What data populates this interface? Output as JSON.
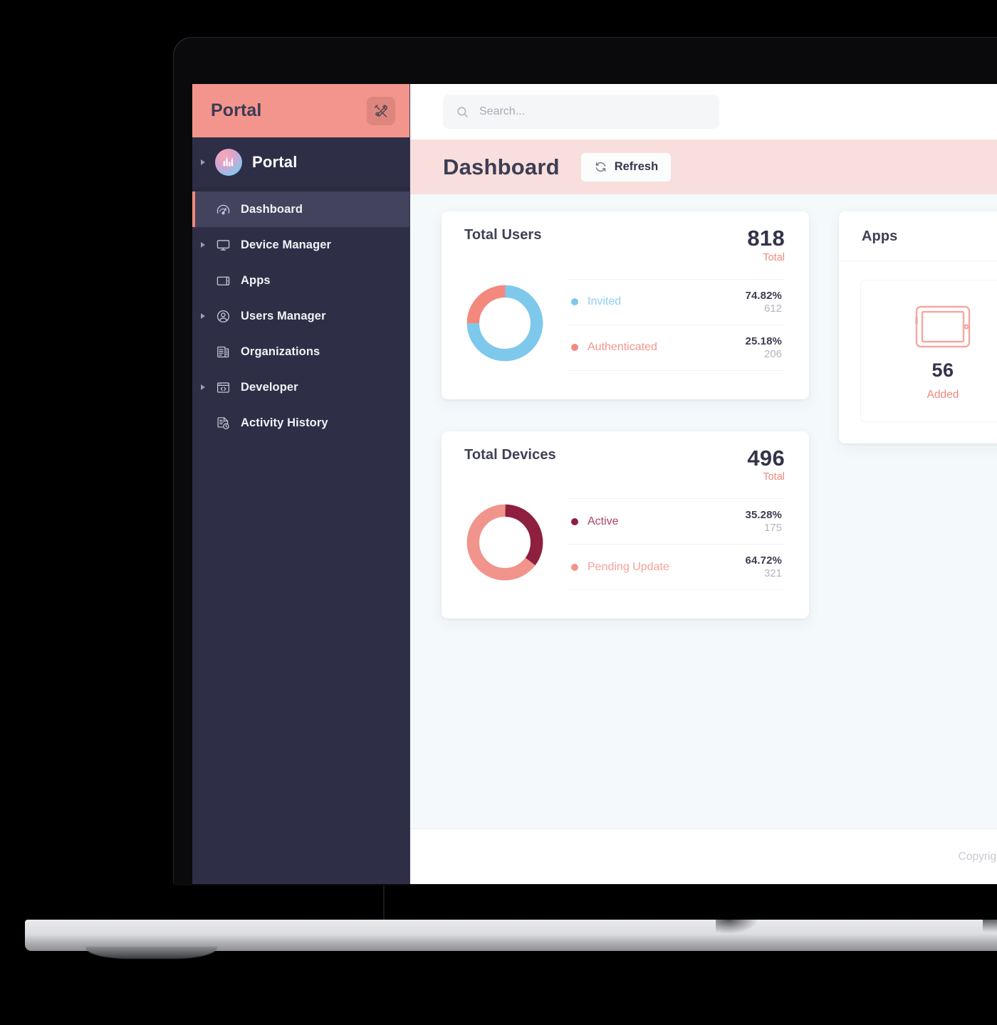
{
  "sidebar": {
    "brand_title": "Portal",
    "tools_icon": "tools-icon",
    "org": {
      "name": "Portal",
      "logo_icon": "portal-logo-icon"
    },
    "items": [
      {
        "label": "Dashboard",
        "icon": "gauge-icon",
        "expandable": false,
        "active": true
      },
      {
        "label": "Device Manager",
        "icon": "monitor-icon",
        "expandable": true,
        "active": false
      },
      {
        "label": "Apps",
        "icon": "tablet-icon",
        "expandable": false,
        "active": false
      },
      {
        "label": "Users Manager",
        "icon": "user-circle-icon",
        "expandable": true,
        "active": false
      },
      {
        "label": "Organizations",
        "icon": "building-icon",
        "expandable": false,
        "active": false
      },
      {
        "label": "Developer",
        "icon": "code-window-icon",
        "expandable": true,
        "active": false
      },
      {
        "label": "Activity History",
        "icon": "document-clock-icon",
        "expandable": false,
        "active": false
      }
    ]
  },
  "topbar": {
    "search_placeholder": "Search...",
    "search_value": "",
    "search_icon": "search-icon"
  },
  "pagebar": {
    "title": "Dashboard",
    "refresh_label": "Refresh",
    "refresh_icon": "refresh-icon"
  },
  "cards": {
    "total_users": {
      "title": "Total Users",
      "total_value": "818",
      "total_label": "Total",
      "rows": [
        {
          "name": "Invited",
          "percent": "74.82%",
          "count": "612",
          "color": "#7ec8ec"
        },
        {
          "name": "Authenticated",
          "percent": "25.18%",
          "count": "206",
          "color": "#f3887d"
        }
      ]
    },
    "total_devices": {
      "title": "Total Devices",
      "total_value": "496",
      "total_label": "Total",
      "rows": [
        {
          "name": "Active",
          "percent": "35.28%",
          "count": "175",
          "color": "#8e1f3f"
        },
        {
          "name": "Pending Update",
          "percent": "64.72%",
          "count": "321",
          "color": "#f1948b"
        }
      ]
    },
    "apps": {
      "title": "Apps",
      "tile": {
        "icon": "tablet-outline-icon",
        "value": "56",
        "label": "Added"
      }
    }
  },
  "footer": {
    "copyright": "Copyright"
  },
  "colors": {
    "brand_salmon": "#f3958c",
    "sidebar_bg": "#2e2e47",
    "pagebar_bg": "#f8dfdd",
    "content_bg": "#f4f9fb",
    "accent": "#f1887d",
    "blue": "#7ec8ec",
    "maroon": "#8e1f3f"
  },
  "chart_data": [
    {
      "type": "pie",
      "title": "Total Users",
      "total": 818,
      "labels": [
        "Invited",
        "Authenticated"
      ],
      "values": [
        612,
        206
      ],
      "percents": [
        74.82,
        25.18
      ],
      "colors": [
        "#7ec8ec",
        "#f3887d"
      ],
      "legend": "right",
      "donut": true
    },
    {
      "type": "pie",
      "title": "Total Devices",
      "total": 496,
      "labels": [
        "Active",
        "Pending Update"
      ],
      "values": [
        175,
        321
      ],
      "percents": [
        35.28,
        64.72
      ],
      "colors": [
        "#8e1f3f",
        "#f1948b"
      ],
      "legend": "right",
      "donut": true
    }
  ]
}
